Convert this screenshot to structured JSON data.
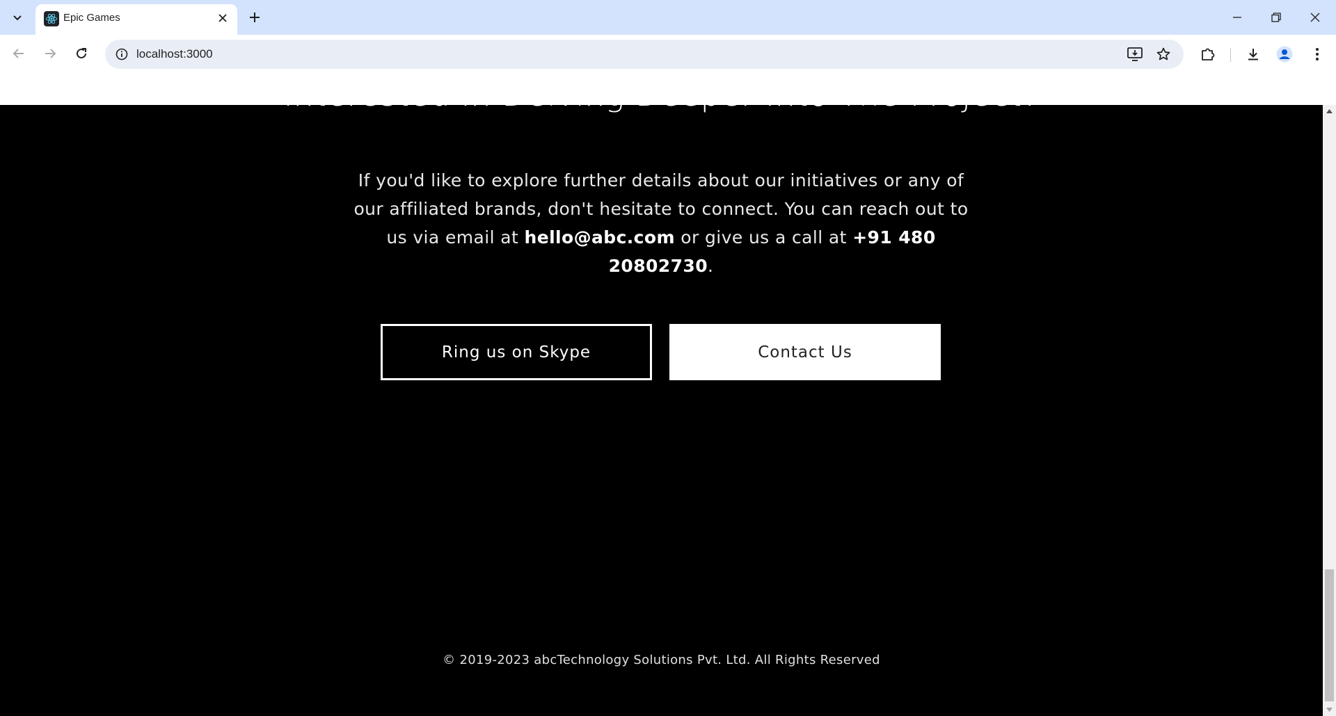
{
  "browser": {
    "tab": {
      "title": "Epic Games",
      "favicon": "react-icon"
    },
    "address": {
      "url": "localhost:3000"
    }
  },
  "page": {
    "heading": "Interested In Delving Deeper Into The Project?",
    "paragraph": {
      "part1": "If you'd like to explore further details about our initiatives or any of our affiliated brands, don't hesitate to connect. You can reach out to us via email at ",
      "email": "hello@abc.com",
      "part2": " or give us a call at ",
      "phone": "+91 480 20802730",
      "part3": "."
    },
    "buttons": {
      "skype": "Ring us on Skype",
      "contact": "Contact Us"
    },
    "footer": "© 2019-2023 abcTechnology Solutions Pvt. Ltd. All Rights Reserved"
  },
  "colors": {
    "tabbar_bg": "#d3e3fd",
    "page_bg": "#000000",
    "omnibox_bg": "#e9eef6"
  }
}
